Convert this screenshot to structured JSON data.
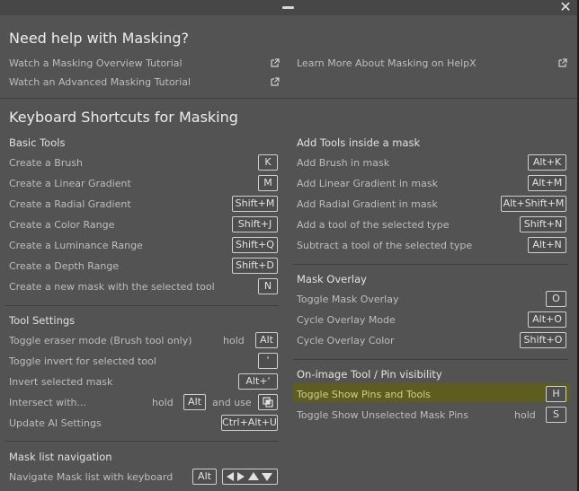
{
  "header": {
    "close_glyph": "✕",
    "help_title": "Need help with Masking?",
    "links": [
      "Watch a Masking Overview Tutorial",
      "Watch an Advanced Masking Tutorial",
      "Learn More About Masking on HelpX"
    ]
  },
  "shortcuts_title": "Keyboard Shortcuts for Masking",
  "left": {
    "basic": {
      "title": "Basic Tools",
      "rows": [
        {
          "label": "Create a Brush",
          "key": "K"
        },
        {
          "label": "Create a Linear Gradient",
          "key": "M"
        },
        {
          "label": "Create a Radial Gradient",
          "key": "Shift+M"
        },
        {
          "label": "Create a Color Range",
          "key": "Shift+J"
        },
        {
          "label": "Create a Luminance Range",
          "key": "Shift+Q"
        },
        {
          "label": "Create a Depth Range",
          "key": "Shift+D"
        },
        {
          "label": "Create a new mask with the selected tool",
          "key": "N"
        }
      ]
    },
    "tool_settings": {
      "title": "Tool Settings",
      "rows": [
        {
          "label": "Toggle eraser mode (Brush tool only)",
          "modifier": "hold",
          "key": "Alt"
        },
        {
          "label": "Toggle invert for selected tool",
          "key": "'"
        },
        {
          "label": "Invert selected mask",
          "key": "Alt+'"
        },
        {
          "label": "Intersect with...",
          "modifier": "hold",
          "key": "Alt",
          "and_use": "and use"
        },
        {
          "label": "Update AI Settings",
          "key": "Ctrl+Alt+U"
        }
      ]
    },
    "mask_list": {
      "title": "Mask list navigation",
      "row": {
        "label": "Navigate Mask list with keyboard",
        "key": "Alt"
      }
    }
  },
  "right": {
    "add_tools": {
      "title": "Add Tools inside a mask",
      "rows": [
        {
          "label": "Add Brush in mask",
          "key": "Alt+K"
        },
        {
          "label": "Add Linear Gradient in mask",
          "key": "Alt+M"
        },
        {
          "label": "Add Radial Gradient in mask",
          "key": "Alt+Shift+M"
        },
        {
          "label": "Add a tool of the selected type",
          "key": "Shift+N"
        },
        {
          "label": "Subtract a tool of the selected type",
          "key": "Alt+N"
        }
      ]
    },
    "overlay": {
      "title": "Mask Overlay",
      "rows": [
        {
          "label": "Toggle Mask Overlay",
          "key": "O"
        },
        {
          "label": "Cycle Overlay Mode",
          "key": "Alt+O"
        },
        {
          "label": "Cycle Overlay Color",
          "key": "Shift+O"
        }
      ]
    },
    "pins": {
      "title": "On-image Tool / Pin visibility",
      "rows": [
        {
          "label": "Toggle Show Pins and Tools",
          "key": "H",
          "highlighted": true
        },
        {
          "label": "Toggle Show Unselected Mask Pins",
          "modifier": "hold",
          "key": "S"
        }
      ]
    }
  },
  "colors": {
    "panel": "#535353",
    "highlight": "#5d5d1f"
  }
}
